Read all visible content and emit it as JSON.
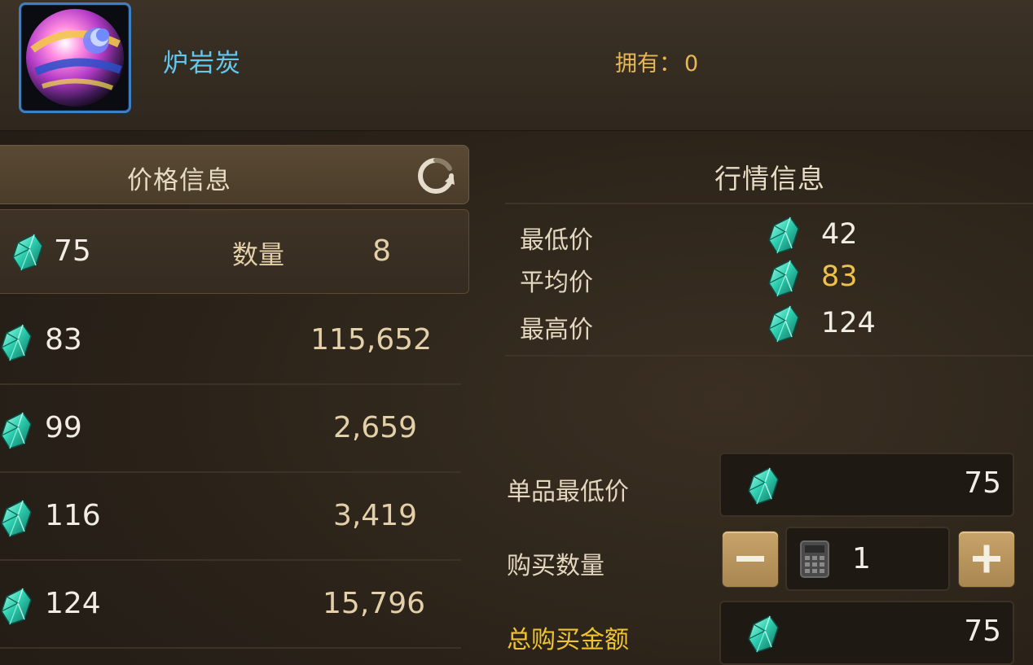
{
  "item": {
    "name": "炉岩炭",
    "owned_label": "拥有：",
    "owned_value": "0",
    "icon": "orb-icon"
  },
  "price_panel": {
    "title": "价格信息",
    "refresh_icon": "refresh-icon",
    "selected": {
      "price": "75",
      "qty_label": "数量",
      "qty": "8"
    },
    "rows": [
      {
        "price": "83",
        "qty": "115,652"
      },
      {
        "price": "99",
        "qty": "2,659"
      },
      {
        "price": "116",
        "qty": "3,419"
      },
      {
        "price": "124",
        "qty": "15,796"
      }
    ]
  },
  "market_panel": {
    "title": "行情信息",
    "stats": [
      {
        "label": "最低价",
        "value": "42",
        "color": "#f1ece4"
      },
      {
        "label": "平均价",
        "value": "83",
        "color": "#efc04a"
      },
      {
        "label": "最高价",
        "value": "124",
        "color": "#f1ece4"
      }
    ]
  },
  "purchase": {
    "unit_price_label": "单品最低价",
    "unit_price": "75",
    "quantity_label": "购买数量",
    "quantity": "1",
    "total_label": "总购买金额",
    "total": "75",
    "minus_icon": "minus-icon",
    "plus_icon": "plus-icon",
    "calculator_icon": "calculator-icon"
  },
  "colors": {
    "gem": "#2fd0b0",
    "item_name": "#63c7ee",
    "owned": "#e6b757",
    "accent_gold": "#f0c431"
  }
}
